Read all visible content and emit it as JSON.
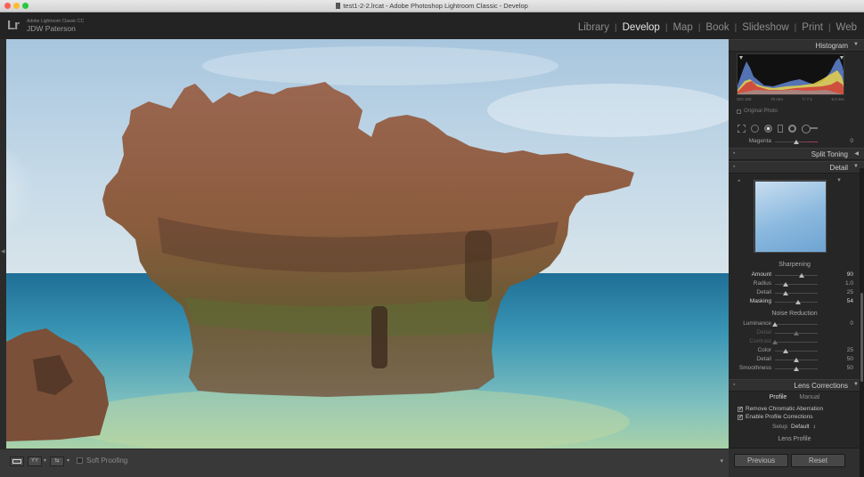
{
  "window": {
    "title": "test1-2-2.lrcat - Adobe Photoshop Lightroom Classic - Develop"
  },
  "identity": {
    "logo": "Lr",
    "app_name": "Adobe Lightroom Classic CC",
    "user": "JDW Paterson"
  },
  "modules": [
    {
      "label": "Library",
      "active": false
    },
    {
      "label": "Develop",
      "active": true
    },
    {
      "label": "Map",
      "active": false
    },
    {
      "label": "Book",
      "active": false
    },
    {
      "label": "Slideshow",
      "active": false
    },
    {
      "label": "Print",
      "active": false
    },
    {
      "label": "Web",
      "active": false
    }
  ],
  "toolbar": {
    "yy_label": "YY",
    "soft_proofing": "Soft Proofing"
  },
  "histogram": {
    "title": "Histogram",
    "iso": "ISO 100",
    "focal": "70 mm",
    "aperture": "f / 7.1",
    "shutter": "5.0 sec",
    "original_photo": "Original Photo"
  },
  "hsl_partial": {
    "label": "Magenta",
    "value": "0"
  },
  "panels": {
    "split_toning": "Split Toning",
    "detail": "Detail",
    "lens_corrections": "Lens Corrections"
  },
  "sharpening": {
    "title": "Sharpening",
    "rows": [
      {
        "label": "Amount",
        "value": "90",
        "pos": 0.63
      },
      {
        "label": "Radius",
        "value": "1.0",
        "pos": 0.25
      },
      {
        "label": "Detail",
        "value": "25",
        "pos": 0.25
      },
      {
        "label": "Masking",
        "value": "54",
        "pos": 0.54
      }
    ]
  },
  "noise_reduction": {
    "title": "Noise Reduction",
    "rows": [
      {
        "label": "Luminance",
        "value": "0",
        "pos": 0.0
      },
      {
        "label": "Detail",
        "value": "",
        "pos": 0.5
      },
      {
        "label": "Contrast",
        "value": "",
        "pos": 0.0
      },
      {
        "label": "Color",
        "value": "25",
        "pos": 0.25
      },
      {
        "label": "Detail",
        "value": "50",
        "pos": 0.5
      },
      {
        "label": "Smoothness",
        "value": "50",
        "pos": 0.5
      }
    ]
  },
  "lens": {
    "tabs": [
      "Profile",
      "Manual"
    ],
    "remove_ca": "Remove Chromatic Aberration",
    "enable_profile": "Enable Profile Corrections",
    "setup_label": "Setup",
    "setup_value": "Default",
    "lens_profile": "Lens Profile"
  },
  "buttons": {
    "previous": "Previous",
    "reset": "Reset"
  },
  "colors": {
    "panel_bg": "#262626",
    "accent_active": "#e6e6e6",
    "sky": "#9bbfd9",
    "sea": "#2a89a8",
    "rock": "#8a5a40"
  }
}
